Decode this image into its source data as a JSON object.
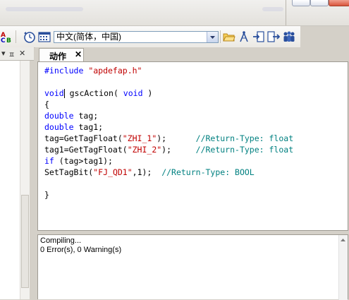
{
  "toolbar": {
    "language_select": "中文(简体，中国)",
    "icons": [
      "font-color-icon",
      "clock-icon",
      "calendar-icon",
      "open-folder-icon",
      "compass-icon",
      "import-icon",
      "export-icon",
      "users-icon"
    ]
  },
  "left_pane": {
    "dock_glyph": "▾",
    "pin_glyph": "ㅍ",
    "close_glyph": "✕"
  },
  "document_tab": {
    "label": "动作",
    "close_glyph": "✕"
  },
  "editor": {
    "lines": [
      {
        "segments": [
          {
            "t": "#include ",
            "c": "blue"
          },
          {
            "t": "\"apdefap.h\"",
            "c": "red"
          }
        ]
      },
      {
        "segments": []
      },
      {
        "segments": [
          {
            "t": "void",
            "c": "blue"
          },
          {
            "caret": true
          },
          {
            "t": " gscAction( ",
            "c": "black"
          },
          {
            "t": "void",
            "c": "blue"
          },
          {
            "t": " )",
            "c": "black"
          }
        ]
      },
      {
        "segments": [
          {
            "t": "{",
            "c": "black"
          }
        ]
      },
      {
        "segments": [
          {
            "t": "double",
            "c": "blue"
          },
          {
            "t": " tag;",
            "c": "black"
          }
        ]
      },
      {
        "segments": [
          {
            "t": "double",
            "c": "blue"
          },
          {
            "t": " tag1;",
            "c": "black"
          }
        ]
      },
      {
        "segments": [
          {
            "t": "tag=GetTagFloat(",
            "c": "black"
          },
          {
            "t": "\"ZHI_1\"",
            "c": "red"
          },
          {
            "t": ");      ",
            "c": "black"
          },
          {
            "t": "//Return-Type: float",
            "c": "green"
          }
        ]
      },
      {
        "segments": [
          {
            "t": "tag1=GetTagFloat(",
            "c": "black"
          },
          {
            "t": "\"ZHI_2\"",
            "c": "red"
          },
          {
            "t": ");     ",
            "c": "black"
          },
          {
            "t": "//Return-Type: float",
            "c": "green"
          }
        ]
      },
      {
        "segments": [
          {
            "t": "if",
            "c": "blue"
          },
          {
            "t": " (tag>tag1);",
            "c": "black"
          }
        ]
      },
      {
        "segments": [
          {
            "t": "SetTagBit(",
            "c": "black"
          },
          {
            "t": "\"FJ_QD1\"",
            "c": "red"
          },
          {
            "t": ",1);  ",
            "c": "black"
          },
          {
            "t": "//Return-Type: BOOL",
            "c": "green"
          }
        ]
      },
      {
        "segments": []
      },
      {
        "segments": [
          {
            "t": "}",
            "c": "black"
          }
        ]
      }
    ]
  },
  "output": {
    "line1": "Compiling...",
    "line2": " 0 Error(s), 0 Warning(s)"
  },
  "colors": {
    "blue": "#0000ff",
    "red": "#c00000",
    "green": "#008080",
    "black": "#000000"
  }
}
